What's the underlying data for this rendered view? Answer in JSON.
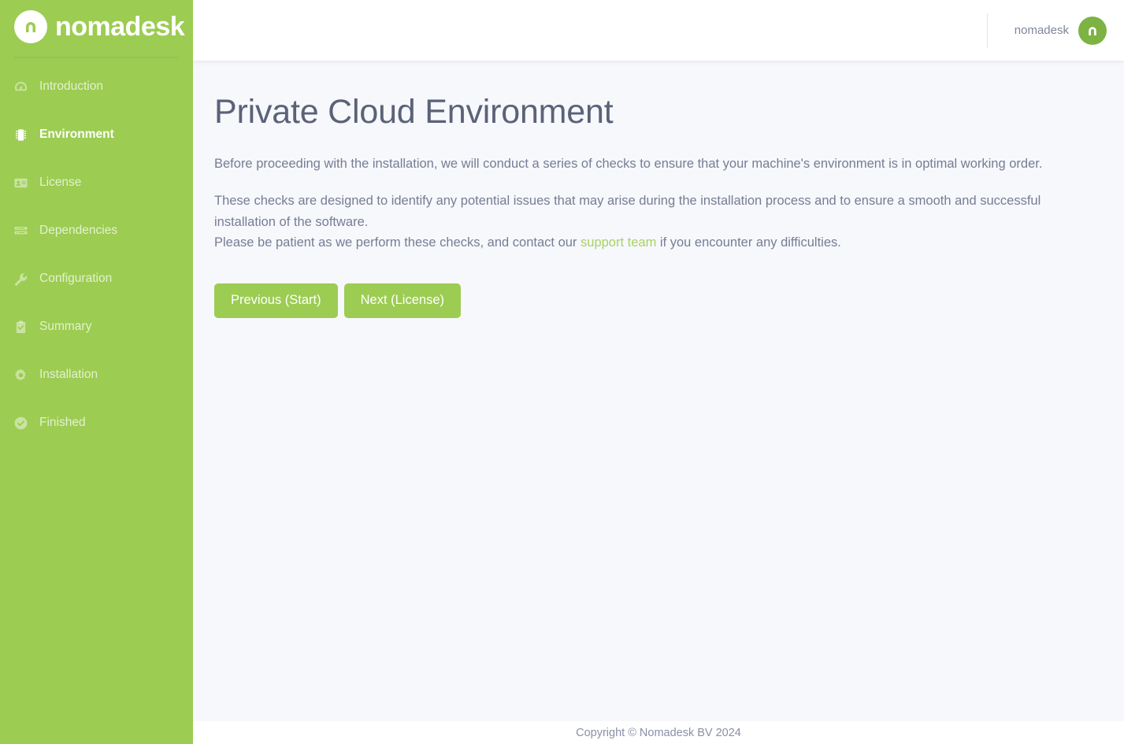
{
  "brand": {
    "sidebar_word": "nomadesk",
    "logo_icon": "nomadesk-arch-logo"
  },
  "topbar": {
    "account_name": "nomadesk",
    "logo_icon": "nomadesk-circle-logo"
  },
  "sidebar": {
    "items": [
      {
        "label": "Introduction",
        "icon": "dashboard-gauge-icon",
        "active": false
      },
      {
        "label": "Environment",
        "icon": "memory-chip-icon",
        "active": true
      },
      {
        "label": "License",
        "icon": "id-card-icon",
        "active": false
      },
      {
        "label": "Dependencies",
        "icon": "server-stack-icon",
        "active": false
      },
      {
        "label": "Configuration",
        "icon": "wrench-icon",
        "active": false
      },
      {
        "label": "Summary",
        "icon": "clipboard-check-icon",
        "active": false
      },
      {
        "label": "Installation",
        "icon": "gear-icon",
        "active": false
      },
      {
        "label": "Finished",
        "icon": "check-circle-icon",
        "active": false
      }
    ]
  },
  "main": {
    "title": "Private Cloud Environment",
    "paragraph_1": "Before proceeding with the installation, we will conduct a series of checks to ensure that your machine's environment is in optimal working order.",
    "paragraph_2_line_1": "These checks are designed to identify any potential issues that may arise during the installation process and to ensure a smooth and successful installation of the software.",
    "paragraph_2_line_2_before_link": "Please be patient as we perform these checks, and contact our ",
    "support_link_text": "support team",
    "paragraph_2_line_2_after_link": " if you encounter any difficulties.",
    "previous_button": "Previous (Start)",
    "next_button": "Next (License)"
  },
  "footer": {
    "copyright": "Copyright © Nomadesk BV 2024"
  },
  "colors": {
    "brand_green": "#9ccc52",
    "topbar_logo_green": "#7cb342",
    "link_green": "#a9d164",
    "content_bg": "#f7f8fc",
    "heading": "#5b6278",
    "body_text": "#767d94"
  }
}
